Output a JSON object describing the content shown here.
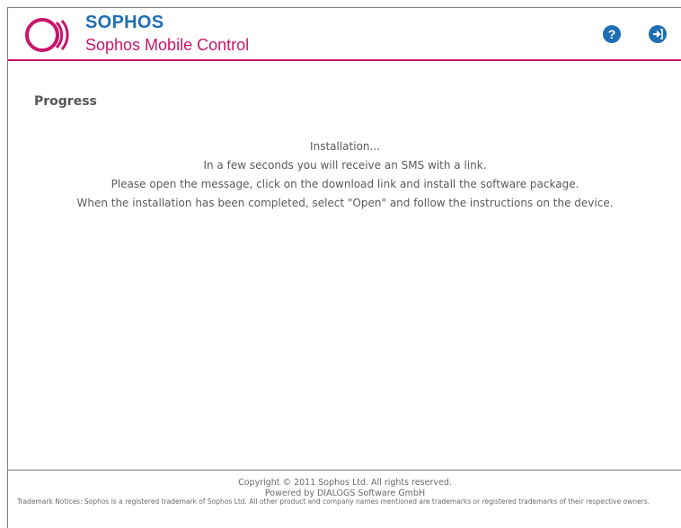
{
  "header": {
    "brand": "SOPHOS",
    "product": "Sophos Mobile Control",
    "help_icon": "?",
    "logout_icon": "⇥",
    "colors": {
      "brand_blue": "#1f6fb5",
      "brand_magenta": "#c8156b"
    }
  },
  "main": {
    "title": "Progress",
    "status": "Installation...",
    "lines": [
      "In a few seconds you will receive an SMS with a link.",
      "Please open the message, click on the download link and install the software package.",
      "When the installation has been completed, select \"Open\" and follow the instructions on the device."
    ]
  },
  "footer": {
    "copyright": "Copyright © 2011 Sophos Ltd. All rights reserved.",
    "powered": "Powered by DIALOGS Software GmbH",
    "trademark": "Trademark Notices: Sophos is a registered trademark of Sophos Ltd. All other product and company names mentioned are trademarks or registered trademarks of their respective owners."
  }
}
